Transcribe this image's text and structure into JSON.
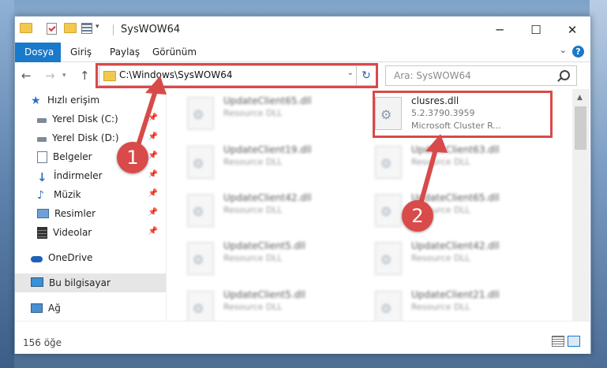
{
  "window": {
    "title": "SysWOW64"
  },
  "ribbon": {
    "tabs": [
      "Dosya",
      "Giriş",
      "Paylaş",
      "Görünüm"
    ]
  },
  "navbar": {
    "address": "C:\\Windows\\SysWOW64",
    "search_placeholder": "Ara: SysWOW64"
  },
  "sidebar": {
    "items": [
      {
        "label": "Hızlı erişim",
        "icon": "star-icon"
      },
      {
        "label": "Yerel Disk (C:)",
        "icon": "drive-icon"
      },
      {
        "label": "Yerel Disk (D:)",
        "icon": "drive-icon"
      },
      {
        "label": "Belgeler",
        "icon": "document-icon"
      },
      {
        "label": "İndirmeler",
        "icon": "download-icon"
      },
      {
        "label": "Müzik",
        "icon": "music-icon"
      },
      {
        "label": "Resimler",
        "icon": "pictures-icon"
      },
      {
        "label": "Videolar",
        "icon": "video-icon"
      },
      {
        "label": "OneDrive",
        "icon": "cloud-icon"
      },
      {
        "label": "Bu bilgisayar",
        "icon": "computer-icon"
      },
      {
        "label": "Ağ",
        "icon": "network-icon"
      }
    ]
  },
  "files": {
    "left": [
      {
        "name": "UpdateClient65.dll",
        "type": "Resource DLL"
      },
      {
        "name": "UpdateClient19.dll",
        "type": "Resource DLL"
      },
      {
        "name": "UpdateClient42.dll",
        "type": "Resource DLL"
      },
      {
        "name": "UpdateClient5.dll",
        "type": "Resource DLL"
      },
      {
        "name": "UpdateClient5.dll",
        "type": "Resource DLL"
      }
    ],
    "highlighted": {
      "name": "clusres.dll",
      "version": "5.2.3790.3959",
      "description": "Microsoft Cluster R..."
    },
    "right": [
      {
        "name": "UpdateClient63.dll",
        "type": "Resource DLL"
      },
      {
        "name": "UpdateClient65.dll",
        "type": "Resource DLL"
      },
      {
        "name": "UpdateClient42.dll",
        "type": "Resource DLL"
      },
      {
        "name": "UpdateClient21.dll",
        "type": "Resource DLL"
      }
    ]
  },
  "status": {
    "item_count": "156 öğe"
  },
  "annotations": {
    "badge1": "1",
    "badge2": "2"
  },
  "colors": {
    "accent": "#1979ca",
    "highlight": "#d84a4a"
  }
}
